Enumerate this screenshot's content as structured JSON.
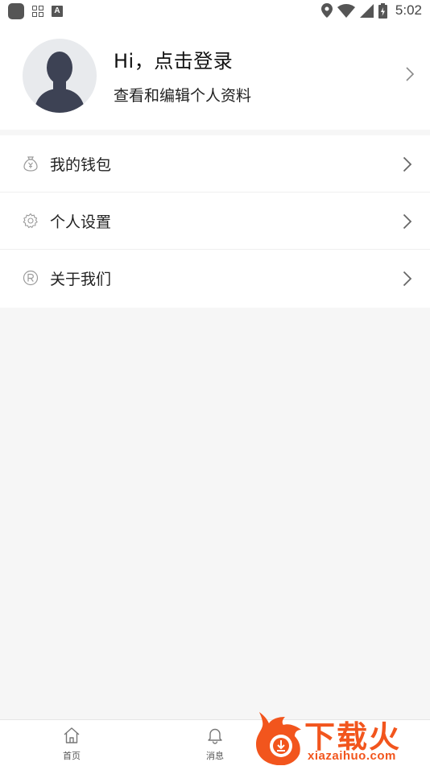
{
  "status_bar": {
    "time": "5:02",
    "icons": [
      "app-icon",
      "grid-icon",
      "a-icon",
      "location-icon",
      "wifi-icon",
      "signal-icon",
      "battery-icon"
    ]
  },
  "profile": {
    "title": "Hi，点击登录",
    "subtitle": "查看和编辑个人资料"
  },
  "menu": {
    "items": [
      {
        "label": "我的钱包",
        "icon": "wallet-icon"
      },
      {
        "label": "个人设置",
        "icon": "gear-icon"
      },
      {
        "label": "关于我们",
        "icon": "registered-icon"
      }
    ]
  },
  "tabbar": {
    "tabs": [
      {
        "label": "首页",
        "icon": "home-icon"
      },
      {
        "label": "消息",
        "icon": "bell-icon"
      }
    ]
  },
  "watermark": {
    "text": "下载火",
    "url": "xiazaihuo.com"
  },
  "colors": {
    "background": "#f6f6f6",
    "card": "#ffffff",
    "text": "#222222",
    "icon_gray": "#9a9a9a",
    "watermark_orange": "#f2551d"
  }
}
